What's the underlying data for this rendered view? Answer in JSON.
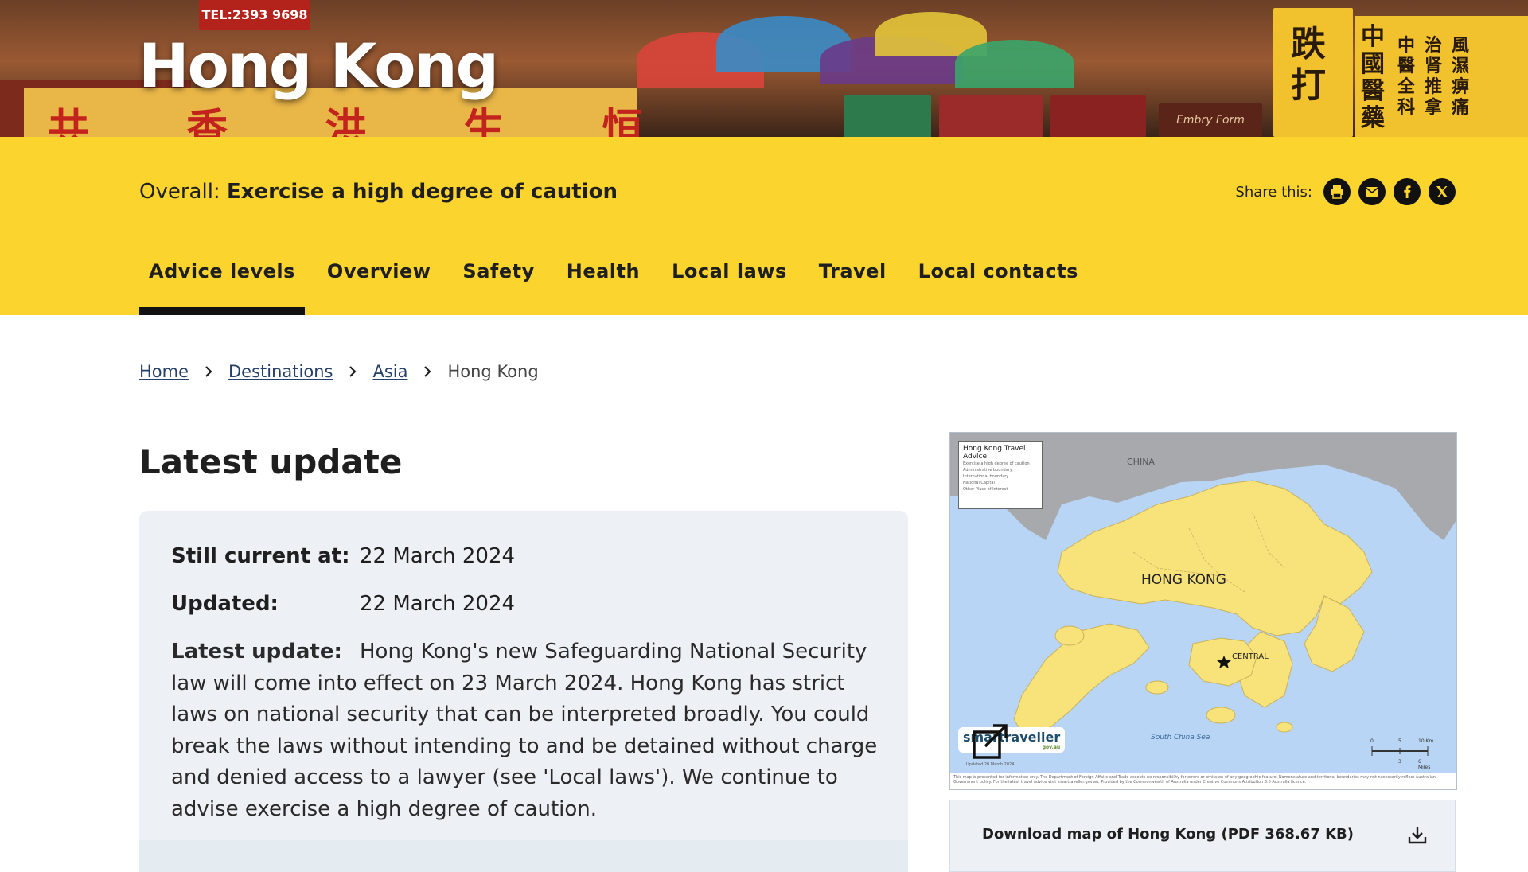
{
  "page": {
    "title": "Hong Kong"
  },
  "overall": {
    "label": "Overall:",
    "level": "Exercise a high degree of caution"
  },
  "share": {
    "label": "Share this:",
    "buttons": [
      "print-icon",
      "email-icon",
      "facebook-icon",
      "x-icon"
    ]
  },
  "tabs": [
    {
      "label": "Advice levels",
      "active": true
    },
    {
      "label": "Overview",
      "active": false
    },
    {
      "label": "Safety",
      "active": false
    },
    {
      "label": "Health",
      "active": false
    },
    {
      "label": "Local laws",
      "active": false
    },
    {
      "label": "Travel",
      "active": false
    },
    {
      "label": "Local contacts",
      "active": false
    }
  ],
  "breadcrumb": [
    {
      "label": "Home",
      "link": true
    },
    {
      "label": "Destinations",
      "link": true
    },
    {
      "label": "Asia",
      "link": true
    },
    {
      "label": "Hong Kong",
      "link": false
    }
  ],
  "latest": {
    "heading": "Latest update",
    "still_current_label": "Still current at:",
    "still_current_value": "22 March 2024",
    "updated_label": "Updated:",
    "updated_value": "22 March 2024",
    "latest_label": "Latest update:",
    "latest_text": "Hong Kong's new Safeguarding National Security law will come into effect on 23 March 2024. Hong Kong has strict laws on national security that can be interpreted broadly. You could break the laws without intending to and be detained without charge and denied access to a lawyer (see 'Local laws'). We continue to advise exercise a high degree of caution."
  },
  "map": {
    "legend_title": "Hong Kong Travel Advice",
    "legend_items": [
      "Exercise a high degree of caution",
      "Administrative boundary",
      "International boundary",
      "National Capital",
      "Other Place of Interest"
    ],
    "label_china": "CHINA",
    "label_hk": "HONG KONG",
    "label_central": "CENTRAL",
    "label_sea": "South China Sea",
    "brand": "smartraveller",
    "brand_sub": "gov.au",
    "scale_km": "10 Km",
    "scale_miles": "6 Miles",
    "scale_0": "0",
    "scale_5": "5",
    "scale_3": "3",
    "updated": "Updated 20 March 2024",
    "disclaimer": "This map is presented for information only. The Department of Foreign Affairs and Trade accepts no responsibility for errors or omission of any geographic feature. Nomenclature and territorial boundaries may not necessarily reflect Australian Government policy. For the latest travel advice visit smartraveller.gov.au. Provided by the Commonwealth of Australia under Creative Commons Attribution 3.0 Australia licence."
  },
  "download": {
    "label": "Download map of Hong Kong (PDF 368.67 KB)"
  },
  "hero_signs": {
    "tel": "TEL:2393 9698",
    "chars_left": "共 香 洪 生 恒",
    "chars_right_a": "跌打",
    "chars_right_b": "中國醫藥",
    "chars_right_c": "中醫全科",
    "chars_right_d": "治肾推拿",
    "chars_right_e": "風濕痹痛",
    "brand_sign": "Embry Form"
  },
  "colors": {
    "band": "#fcd42e",
    "panel": "#edf1f5",
    "link": "#26406b",
    "land": "#f8e27a",
    "sea": "#b9d5f6",
    "china": "#a8a9ad"
  }
}
